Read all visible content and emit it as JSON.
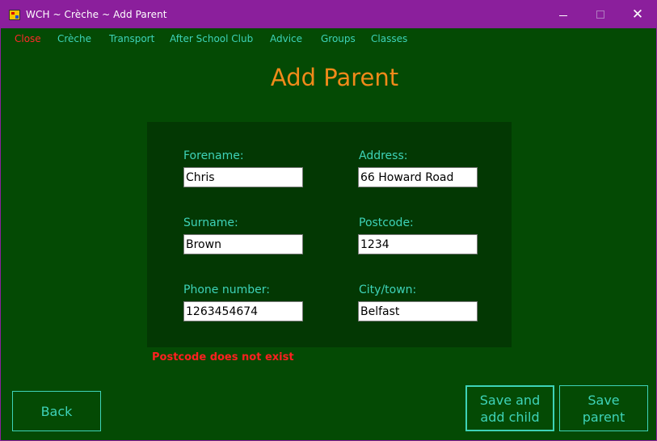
{
  "window": {
    "title": "WCH ~ Crèche ~ Add Parent",
    "controls": {
      "minimize": "",
      "maximize": "",
      "close": "✕"
    }
  },
  "menu": {
    "items": [
      {
        "label": "Close"
      },
      {
        "label": "Crèche"
      },
      {
        "label": "Transport"
      },
      {
        "label": "After School Club"
      },
      {
        "label": "Advice"
      },
      {
        "label": "Groups"
      },
      {
        "label": "Classes"
      }
    ]
  },
  "page": {
    "title": "Add Parent"
  },
  "form": {
    "forename": {
      "label": "Forename:",
      "value": "Chris"
    },
    "surname": {
      "label": "Surname:",
      "value": "Brown"
    },
    "phone": {
      "label": "Phone number:",
      "value": "1263454674"
    },
    "address": {
      "label": "Address:",
      "value": "66 Howard Road"
    },
    "postcode": {
      "label": "Postcode:",
      "value": "1234"
    },
    "city": {
      "label": "City/town:",
      "value": "Belfast"
    }
  },
  "error": {
    "message": "Postcode does not exist"
  },
  "buttons": {
    "back": "Back",
    "save_and_add_child_line1": "Save and",
    "save_and_add_child_line2": "add child",
    "save_parent_line1": "Save",
    "save_parent_line2": "parent"
  },
  "colors": {
    "titlebar": "#8b1f9c",
    "background": "#044a04",
    "panel": "#033803",
    "accent": "#3ed3b8",
    "title": "#f08a1a",
    "error": "#ff2020"
  }
}
